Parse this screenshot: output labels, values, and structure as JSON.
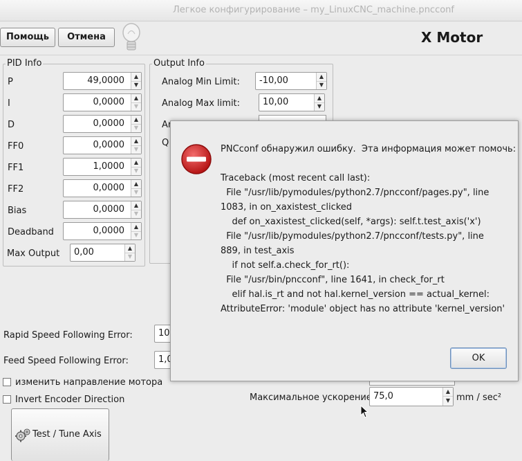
{
  "window": {
    "title": "Легкое конфигурирование – my_LinuxCNC_machine.pncconf"
  },
  "toolbar": {
    "help_label": "Помощь",
    "cancel_label": "Отмена",
    "hint_icon": "lightbulb-icon",
    "page_heading": "X Motor"
  },
  "pid": {
    "legend": "PID Info",
    "rows": [
      {
        "label": "P",
        "value": "49,0000"
      },
      {
        "label": "I",
        "value": "0,0000"
      },
      {
        "label": "D",
        "value": "0,0000"
      },
      {
        "label": "FF0",
        "value": "0,0000"
      },
      {
        "label": "FF1",
        "value": "1,0000"
      },
      {
        "label": "FF2",
        "value": "0,0000"
      },
      {
        "label": "Bias",
        "value": "0,0000"
      },
      {
        "label": "Deadband",
        "value": "0,0000"
      }
    ],
    "max_output_label": "Max Output",
    "max_output_value": "0,00"
  },
  "output": {
    "legend": "Output Info",
    "analog_min_label": "Analog Min Limit:",
    "analog_min_value": "-10,00",
    "analog_max_label": "Analog Max limit:",
    "analog_max_value": "10,00",
    "partial_label_1": "Ar",
    "partial_label_2": "Q"
  },
  "errors": {
    "rapid_label": "Rapid Speed Following Error:",
    "rapid_value": "10,",
    "feed_label": "Feed Speed Following Error:",
    "feed_value": "1,0"
  },
  "options": {
    "reverse_motor_label": "изменить направление мотора",
    "invert_encoder_label": "Invert Encoder Direction"
  },
  "accel": {
    "label": "Максимальное ускорение:",
    "value": "75,0",
    "unit": "mm / sec²"
  },
  "test_button": {
    "label": "Test / Tune Axis",
    "icon": "gears-icon"
  },
  "dialog": {
    "icon": "error-icon",
    "error_color": "#cc1f1f",
    "message_lines": [
      "PNCconf обнаружил ошибку.  Эта информация может помочь:",
      "",
      "Traceback (most recent call last):",
      "  File \"/usr/lib/pymodules/python2.7/pncconf/pages.py\", line",
      "1083, in on_xaxistest_clicked",
      "    def on_xaxistest_clicked(self, *args): self.t.test_axis('x')",
      "  File \"/usr/lib/pymodules/python2.7/pncconf/tests.py\", line",
      "889, in test_axis",
      "    if not self.a.check_for_rt():",
      "  File \"/usr/bin/pncconf\", line 1641, in check_for_rt",
      "    elif hal.is_rt and not hal.kernel_version == actual_kernel:",
      "AttributeError: 'module' object has no attribute 'kernel_version'"
    ],
    "ok_label": "OK"
  }
}
